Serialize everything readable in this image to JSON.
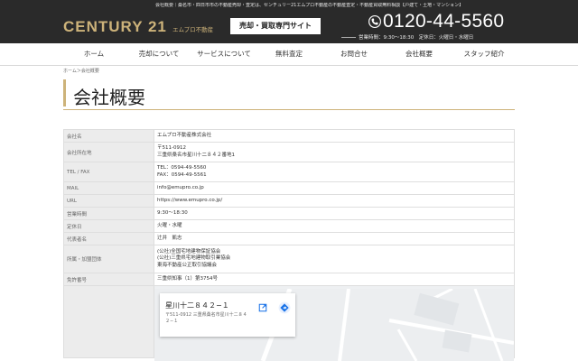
{
  "header": {
    "tagline": "会社概要｜桑名市・四日市市の不動産売却・査定は、センチュリー21エムプロ不動産の不動産査定・不動産買取無料相談【戸建て・土地・マンション】",
    "logo": "CENTURY 21",
    "logo_sub": "エムプロ不動産",
    "cta_label": "売却・買取専門サイト",
    "phone": "0120-44-5560",
    "hours": "営業時間：9:30〜18:30　定休日：火曜日・水曜日",
    "icons": {
      "phone": "phone-icon"
    },
    "colors": {
      "header_bg": "#2a2a2a",
      "gold": "#cdb37a"
    }
  },
  "nav": {
    "items": [
      {
        "label": "ホーム"
      },
      {
        "label": "売却について"
      },
      {
        "label": "サービスについて"
      },
      {
        "label": "無料査定"
      },
      {
        "label": "お問合せ"
      },
      {
        "label": "会社概要"
      },
      {
        "label": "スタッフ紹介"
      }
    ]
  },
  "breadcrumb": "ホーム＞会社概要",
  "page_title": "会社概要",
  "company": {
    "name_label": "会社名",
    "name": "エムプロ不動産株式会社",
    "address_label": "会社所在地",
    "postal": "〒511-0912",
    "address": "三重県桑名市星川十二８４２番地1",
    "tel_fax_label": "TEL / FAX",
    "tel": "TEL：0594-49-5560",
    "fax": "FAX：0594-49-5561",
    "mail_label": "MAIL",
    "mail": "info@emupro.co.jp",
    "url_label": "URL",
    "url": "https://www.emupro.co.jp/",
    "hours_label": "営業時間",
    "hours": "9:30〜18:30",
    "holiday_label": "定休日",
    "holiday": "火曜・水曜",
    "rep_label": "代表者名",
    "rep": "辻井　凱志",
    "groups_label": "所属・加盟団体",
    "groups": [
      "(公社)全国宅地建物保証協会",
      "(公社)三重県宅地建物取引業協会",
      "東海不動産公正取引協議会"
    ],
    "license_label": "免許番号",
    "license": "三重県知事（1）第3754号"
  },
  "map": {
    "place_name": "星川十二８４２−１",
    "place_addr": "〒511-0912 三重県桑名市星川十二８４２−１",
    "icons": {
      "open": "open-in-new-icon",
      "directions": "directions-icon"
    }
  }
}
